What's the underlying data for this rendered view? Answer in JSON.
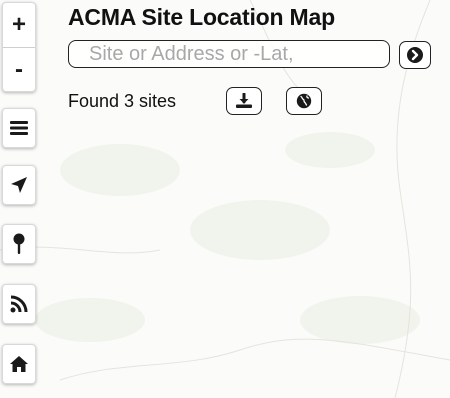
{
  "app": {
    "title": "ACMA Site Location Map"
  },
  "search": {
    "placeholder": "Site or Address or -Lat,",
    "value": "",
    "go_icon": "arrow-circle-right-icon"
  },
  "results": {
    "found_text": "Found 3 sites",
    "download_icon": "download-icon",
    "globe_icon": "globe-icon"
  },
  "map_controls": [
    {
      "name": "zoom-in",
      "label": "+"
    },
    {
      "name": "zoom-out",
      "label": "-"
    },
    {
      "name": "layers",
      "icon": "menu-icon"
    },
    {
      "name": "locate",
      "icon": "location-arrow-icon"
    },
    {
      "name": "drop-pin",
      "icon": "map-pin-icon"
    },
    {
      "name": "feed",
      "icon": "rss-icon"
    },
    {
      "name": "home",
      "icon": "home-icon"
    }
  ],
  "colors": {
    "map_background": "#fbfbf9",
    "button_text": "#1a1a1a"
  }
}
